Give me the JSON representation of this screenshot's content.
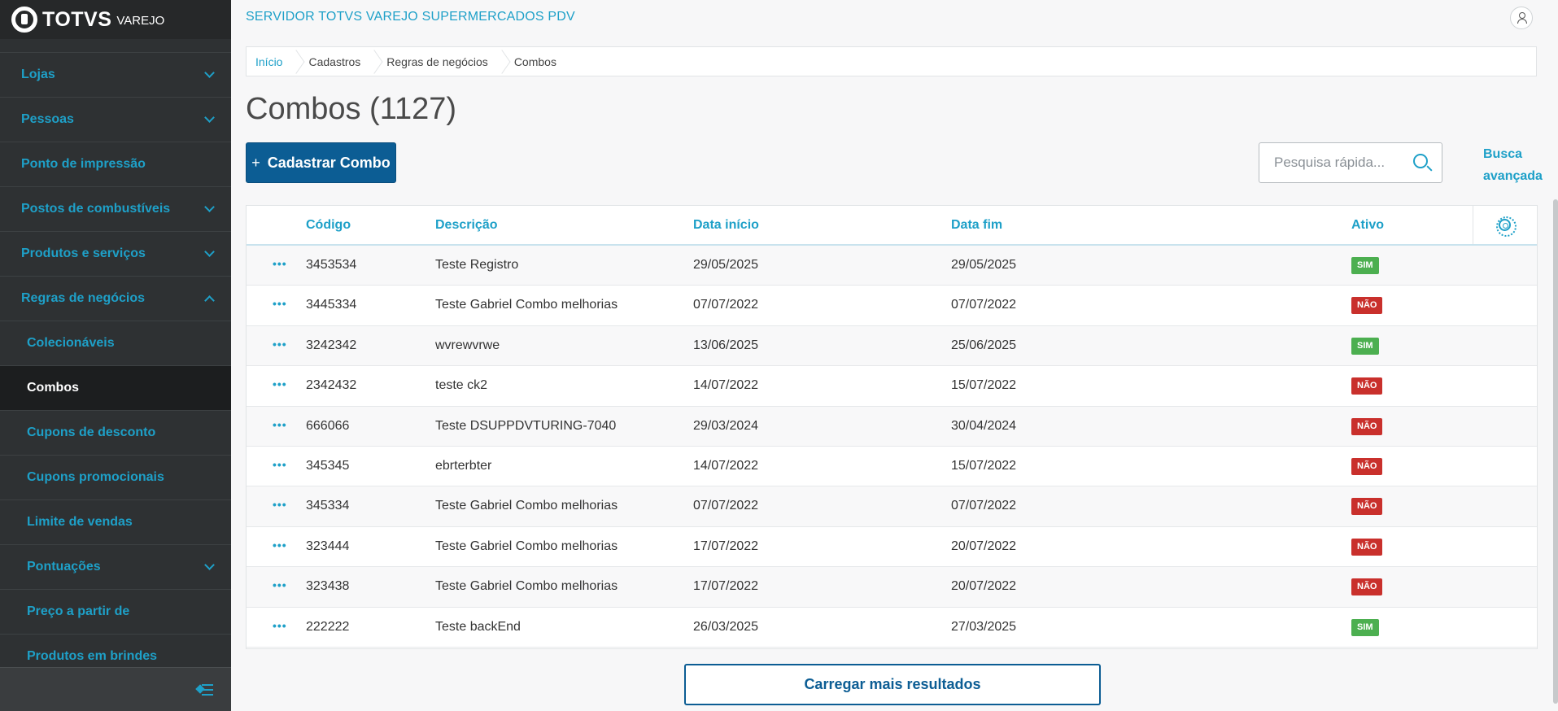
{
  "brand": {
    "name": "TOTVS",
    "product": "VAREJO"
  },
  "header": {
    "title": "SERVIDOR TOTVS VAREJO SUPERMERCADOS PDV"
  },
  "sidebar": {
    "items": [
      {
        "label": "Lojas"
      },
      {
        "label": "Pessoas"
      },
      {
        "label": "Ponto de impressão"
      },
      {
        "label": "Postos de combustíveis"
      },
      {
        "label": "Produtos e serviços"
      },
      {
        "label": "Regras de negócios"
      },
      {
        "label": "Colecionáveis"
      },
      {
        "label": "Combos"
      },
      {
        "label": "Cupons de desconto"
      },
      {
        "label": "Cupons promocionais"
      },
      {
        "label": "Limite de vendas"
      },
      {
        "label": "Pontuações"
      },
      {
        "label": "Preço a partir de"
      },
      {
        "label": "Produtos em brindes"
      }
    ]
  },
  "breadcrumb": [
    "Início",
    "Cadastros",
    "Regras de negócios",
    "Combos"
  ],
  "page": {
    "title": "Combos (1127)",
    "add_button": "Cadastrar Combo",
    "search_placeholder": "Pesquisa rápida...",
    "advanced_search": "Busca avançada",
    "load_more": "Carregar mais resultados"
  },
  "table": {
    "columns": [
      "Código",
      "Descrição",
      "Data início",
      "Data fim",
      "Ativo"
    ],
    "rows": [
      {
        "code": "3453534",
        "desc": "Teste Registro",
        "start": "29/05/2025",
        "end": "29/05/2025",
        "active": "SIM"
      },
      {
        "code": "3445334",
        "desc": "Teste Gabriel Combo melhorias",
        "start": "07/07/2022",
        "end": "07/07/2022",
        "active": "NÃO"
      },
      {
        "code": "3242342",
        "desc": "wvrewvrwe",
        "start": "13/06/2025",
        "end": "25/06/2025",
        "active": "SIM"
      },
      {
        "code": "2342432",
        "desc": "teste ck2",
        "start": "14/07/2022",
        "end": "15/07/2022",
        "active": "NÃO"
      },
      {
        "code": "666066",
        "desc": "Teste DSUPPDVTURING-7040",
        "start": "29/03/2024",
        "end": "30/04/2024",
        "active": "NÃO"
      },
      {
        "code": "345345",
        "desc": "ebrterbter",
        "start": "14/07/2022",
        "end": "15/07/2022",
        "active": "NÃO"
      },
      {
        "code": "345334",
        "desc": "Teste Gabriel Combo melhorias",
        "start": "07/07/2022",
        "end": "07/07/2022",
        "active": "NÃO"
      },
      {
        "code": "323444",
        "desc": "Teste Gabriel Combo melhorias",
        "start": "17/07/2022",
        "end": "20/07/2022",
        "active": "NÃO"
      },
      {
        "code": "323438",
        "desc": "Teste Gabriel Combo melhorias",
        "start": "17/07/2022",
        "end": "20/07/2022",
        "active": "NÃO"
      },
      {
        "code": "222222",
        "desc": "Teste backEnd",
        "start": "26/03/2025",
        "end": "27/03/2025",
        "active": "SIM"
      }
    ]
  },
  "colors": {
    "accent": "#1ea0c8",
    "primary": "#0c5d94",
    "sidebar": "#2e3133",
    "yes": "#4caf50",
    "no": "#c9302c"
  },
  "icons": [
    "totvs-logo-icon",
    "chevron-down-icon",
    "chevron-up-icon",
    "collapse-menu-icon",
    "user-icon",
    "search-icon",
    "gear-icon",
    "more-actions-icon"
  ]
}
